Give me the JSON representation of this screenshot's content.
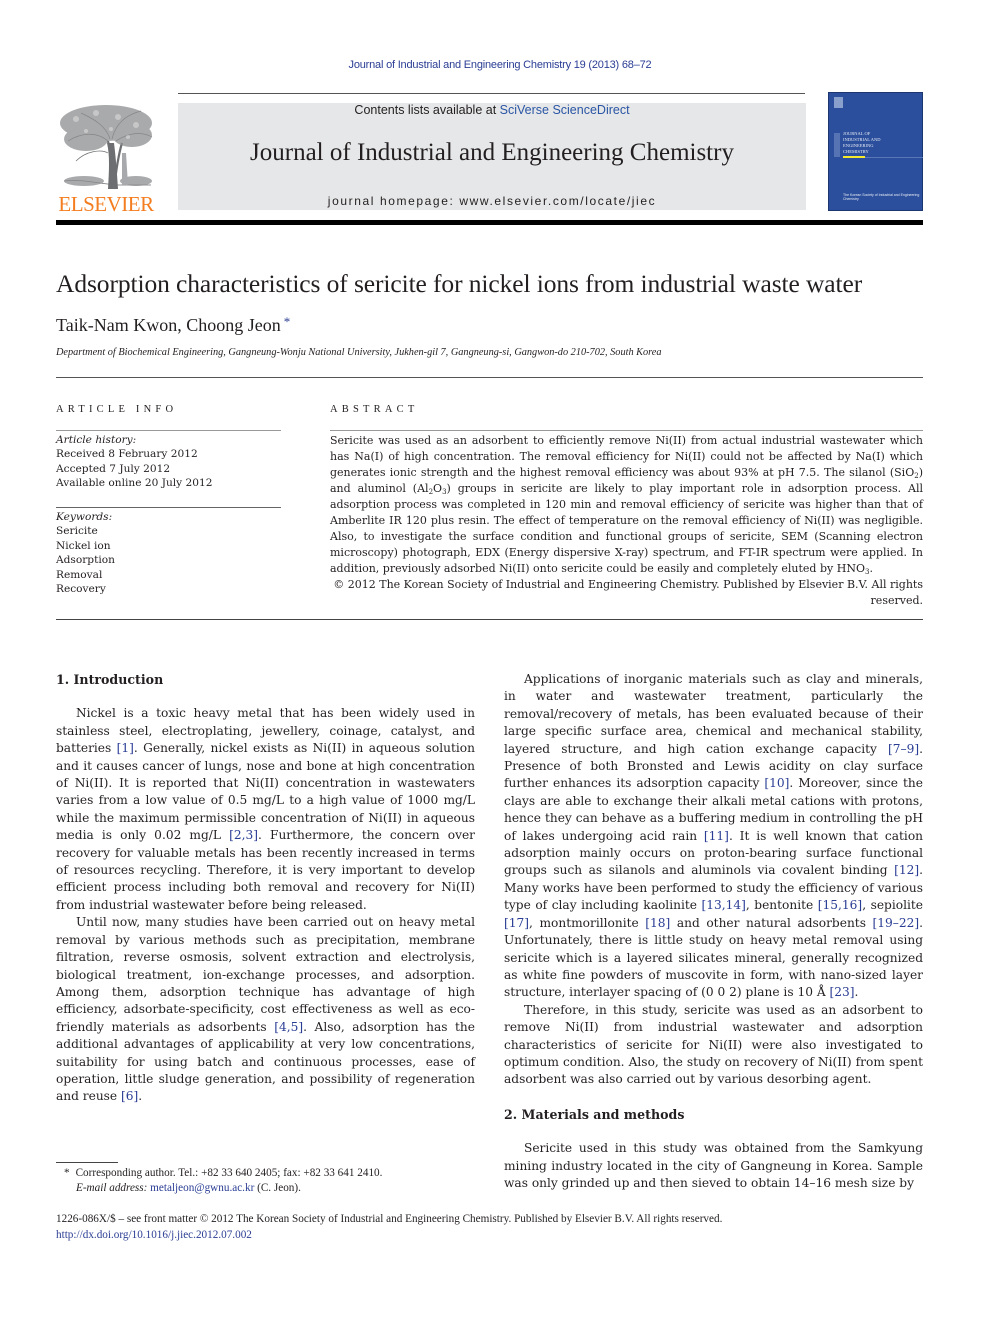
{
  "header": {
    "running_head": "Journal of Industrial and Engineering Chemistry 19 (2013) 68–72",
    "contents_prefix": "Contents lists available at ",
    "contents_link": "SciVerse ScienceDirect",
    "journal_name": "Journal of Industrial and Engineering Chemistry",
    "homepage": "journal homepage: www.elsevier.com/locate/jiec",
    "publisher_logo_text": "ELSEVIER",
    "cover_title_lines": [
      "Journal of",
      "Industrial and",
      "Engineering",
      "Chemistry"
    ],
    "cover_footer": "The Korean Society of Industrial and Engineering Chemistry",
    "colors": {
      "link": "#2a3d94",
      "elsevier_orange": "#f47d20",
      "cover_blue": "#2b4f9c",
      "masthead_gray": "#e6e7e8"
    }
  },
  "article": {
    "title": "Adsorption characteristics of sericite for nickel ions from industrial waste water",
    "authors": "Taik-Nam Kwon, Choong Jeon",
    "corresponding_mark": "*",
    "affiliation": "Department of Biochemical Engineering, Gangneung-Wonju National University, Jukhen-gil 7, Gangneung-si, Gangwon-do 210-702, South Korea"
  },
  "article_info": {
    "heading": "ARTICLE INFO",
    "history_label": "Article history:",
    "history": [
      "Received 8 February 2012",
      "Accepted 7 July 2012",
      "Available online 20 July 2012"
    ],
    "keywords_label": "Keywords:",
    "keywords": [
      "Sericite",
      "Nickel ion",
      "Adsorption",
      "Removal",
      "Recovery"
    ]
  },
  "abstract": {
    "heading": "ABSTRACT",
    "t1": "Sericite was used as an adsorbent to efficiently remove Ni(II) from actual industrial wastewater which has Na(I) of high concentration. The removal efficiency for Ni(II) could not be affected by Na(I) which generates ionic strength and the highest removal efficiency was about 93% at pH 7.5. The silanol (SiO",
    "s1": "2",
    "t2": ") and aluminol (Al",
    "s2": "2",
    "t3": "O",
    "s3": "3",
    "t4": ") groups in sericite are likely to play important role in adsorption process. All adsorption process was completed in 120 min and removal efficiency of sericite was higher than that of Amberlite IR 120 plus resin. The effect of temperature on the removal efficiency of Ni(II) was negligible. Also, to investigate the surface condition and functional groups of sericite, SEM (Scanning electron microscopy) photograph, EDX (Energy dispersive X-ray) spectrum, and FT-IR spectrum were applied. In addition, previously adsorbed Ni(II) onto sericite could be easily and completely eluted by HNO",
    "s4": "3",
    "t5": ".",
    "copyright": "© 2012 The Korean Society of Industrial and Engineering Chemistry. Published by Elsevier B.V. All rights reserved."
  },
  "body": {
    "sec1_heading": "1.  Introduction",
    "p1": {
      "a": "Nickel is a toxic heavy metal that has been widely used in stainless steel, electroplating, jewellery, coinage, catalyst, and batteries ",
      "r1": "[1]",
      "b": ". Generally, nickel exists as Ni(II) in aqueous solution and it causes cancer of lungs, nose and bone at high concentration of Ni(II). It is reported that Ni(II) concentration in wastewaters varies from a low value of 0.5 mg/L to a high value of 1000 mg/L while the maximum permissible concentration of Ni(II) in aqueous media is only 0.02 mg/L ",
      "r2": "[2,3]",
      "c": ". Furthermore, the concern over recovery for valuable metals has been recently increased in terms of resources recycling. Therefore, it is very important to develop efficient process including both removal and recovery for Ni(II) from industrial wastewater before being released."
    },
    "p2": {
      "a": "Until now, many studies have been carried out on heavy metal removal by various methods such as precipitation, membrane filtration, reverse osmosis, solvent extraction and electrolysis, biological treatment, ion-exchange processes, and adsorption. Among them, adsorption technique has advantage of high efficiency, adsorbate-specificity, cost effectiveness as well as eco-friendly materials as adsorbents ",
      "r1": "[4,5]",
      "b": ". Also, adsorption has the additional advantages of applicability at very low concentrations, suitability for using batch and continuous processes, ease of operation, little sludge generation, and possibility of regeneration and reuse ",
      "r2": "[6]",
      "c": "."
    },
    "p3": {
      "a": "Applications of inorganic materials such as clay and minerals, in water and wastewater treatment, particularly the removal/recovery of metals, has been evaluated because of their large specific surface area, chemical and mechanical stability, layered structure, and high cation exchange capacity ",
      "r1": "[7–9]",
      "b": ". Presence of both Bronsted and Lewis acidity on clay surface further enhances its adsorption capacity ",
      "r2": "[10]",
      "c": ". Moreover, since the clays are able to exchange their alkali metal cations with protons, hence they can behave as a buffering medium in controlling the pH of lakes undergoing acid rain ",
      "r3": "[11]",
      "d": ". It is well known that cation adsorption mainly occurs on proton-bearing surface functional groups such as silanols and aluminols via covalent binding ",
      "r4": "[12]",
      "e": ". Many works have been performed to study the efficiency of various type of clay including kaolinite ",
      "r5": "[13,14]",
      "f": ", bentonite ",
      "r6": "[15,16]",
      "g": ", sepiolite ",
      "r7": "[17]",
      "h": ", montmorillonite ",
      "r8": "[18]",
      "i": " and other natural adsorbents ",
      "r9": "[19–22]",
      "j": ". Unfortunately, there is little study on heavy metal removal using sericite which is a layered silicates mineral, generally recognized as white fine powders of muscovite in form, with nano-sized layer structure, interlayer spacing of (0 0 2) plane is 10 Å ",
      "r10": "[23]",
      "k": "."
    },
    "p4": "Therefore, in this study, sericite was used as an adsorbent to remove Ni(II) from industrial wastewater and adsorption characteristics of sericite for Ni(II) were also investigated to optimum condition. Also, the study on recovery of Ni(II) from spent adsorbent was also carried out by various desorbing agent.",
    "sec2_heading": "2.  Materials and methods",
    "p5": "Sericite used in this study was obtained from the Samkyung mining industry located in the city of Gangneung in Korea. Sample was only grinded up and then sieved to obtain 14–16 mesh size by"
  },
  "footnote": {
    "star": "*",
    "corresponding": "Corresponding author. Tel.: +82 33 640 2405; fax: +82 33 641 2410.",
    "email_label": "E-mail address:",
    "email": "metaljeon@gwnu.ac.kr",
    "email_suffix": " (C. Jeon)."
  },
  "bottom": {
    "front_matter": "1226-086X/$ – see front matter © 2012 The Korean Society of Industrial and Engineering Chemistry. Published by Elsevier B.V. All rights reserved.",
    "doi": "http://dx.doi.org/10.1016/j.jiec.2012.07.002"
  }
}
